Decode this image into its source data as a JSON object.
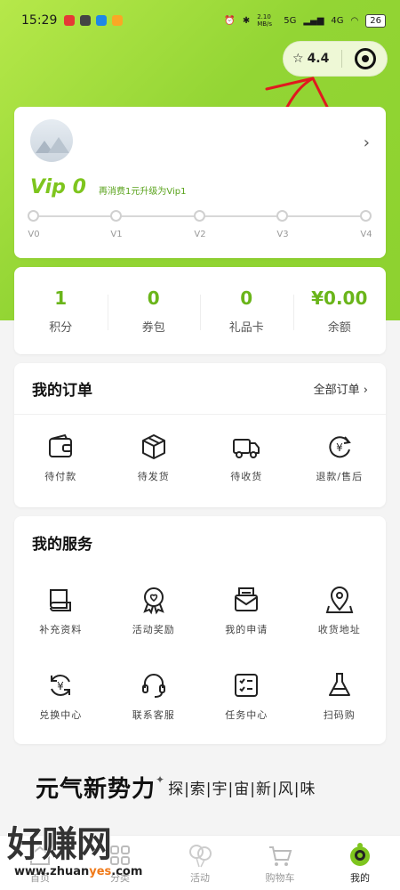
{
  "status_bar": {
    "time": "15:29",
    "speed": "2.10 MB/s",
    "net1": "5G",
    "net2": "4G",
    "battery": "26"
  },
  "capsule": {
    "rating": "4.4"
  },
  "vip": {
    "level": "Vip 0",
    "tip": "再消费1元升级为Vip1",
    "levels": [
      "V0",
      "V1",
      "V2",
      "V3",
      "V4"
    ]
  },
  "stats": [
    {
      "value": "1",
      "label": "积分"
    },
    {
      "value": "0",
      "label": "券包"
    },
    {
      "value": "0",
      "label": "礼品卡"
    },
    {
      "value": "¥0.00",
      "label": "余额"
    }
  ],
  "orders": {
    "title": "我的订单",
    "more": "全部订单 ›",
    "items": [
      {
        "label": "待付款",
        "icon": "wallet-icon"
      },
      {
        "label": "待发货",
        "icon": "box-icon"
      },
      {
        "label": "待收货",
        "icon": "truck-icon"
      },
      {
        "label": "退款/售后",
        "icon": "refund-icon"
      }
    ]
  },
  "services": {
    "title": "我的服务",
    "items": [
      {
        "label": "补充资料",
        "icon": "book-icon"
      },
      {
        "label": "活动奖励",
        "icon": "award-icon"
      },
      {
        "label": "我的申请",
        "icon": "mail-icon"
      },
      {
        "label": "收货地址",
        "icon": "location-icon"
      },
      {
        "label": "兑换中心",
        "icon": "exchange-icon"
      },
      {
        "label": "联系客服",
        "icon": "headset-icon"
      },
      {
        "label": "任务中心",
        "icon": "checklist-icon"
      },
      {
        "label": "扫码购",
        "icon": "flask-icon"
      }
    ]
  },
  "banner": {
    "main": "元气新势力",
    "sub": "探|索|宇|宙|新|风|味"
  },
  "tabs": [
    "首页",
    "分类",
    "活动",
    "购物车",
    "我的"
  ],
  "watermark": {
    "text": "好赚网",
    "url_pre": "www.zhuan",
    "url_hl": "yes",
    "url_post": ".com"
  },
  "colors": {
    "accent": "#7ec51e",
    "hero": "#93d534"
  }
}
